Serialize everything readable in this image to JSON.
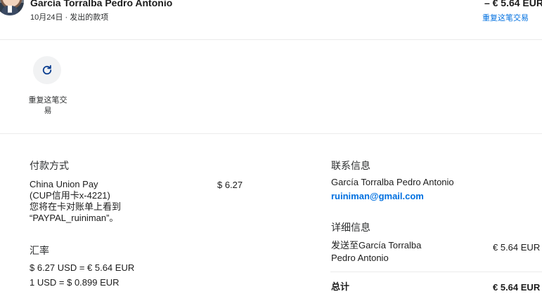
{
  "header": {
    "name": "García Torralba Pedro Antonio",
    "subline": "10月24日 · 发出的款项",
    "amount": "– € 5.64 EUR",
    "repeat_link": "重复这笔交易"
  },
  "actions": {
    "repeat_label_line1": "重复这笔交",
    "repeat_label_line2": "易",
    "repeat_icon": "refresh-icon"
  },
  "payment": {
    "title": "付款方式",
    "method_line1": "China Union Pay",
    "method_line2": "(CUP信用卡x-4221)",
    "method_line3": "您将在卡对账单上看到",
    "method_line4": "“PAYPAL_ruiniman”。",
    "amount": "$ 6.27"
  },
  "exchange": {
    "title": "汇率",
    "line1": "$ 6.27 USD = € 5.64 EUR",
    "line2": "1 USD = $ 0.899 EUR"
  },
  "contact": {
    "title": "联系信息",
    "name": "García Torralba Pedro Antonio",
    "email": "ruiniman@gmail.com"
  },
  "details": {
    "title": "详细信息",
    "sent_to_line1": "发送至García Torralba",
    "sent_to_line2": "Pedro Antonio",
    "sent_amount": "€ 5.64 EUR",
    "total_label": "总计",
    "total_amount": "€ 5.64 EUR"
  }
}
